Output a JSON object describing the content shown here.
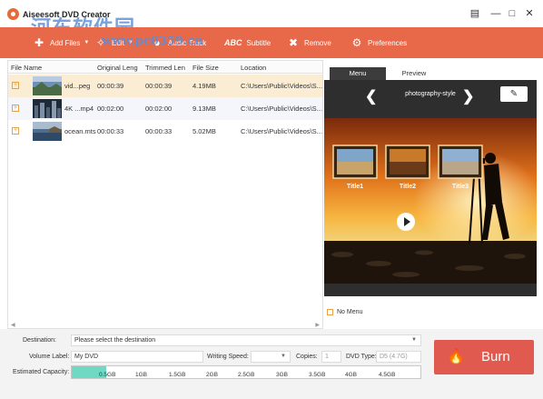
{
  "window": {
    "title": "Aiseesoft DVD Creator",
    "watermark": "河东软件园",
    "watermark_url": "www.pc0359.cn"
  },
  "toolbar": {
    "items": [
      {
        "label": "Add Files",
        "icon": "add-files-icon",
        "caret": true
      },
      {
        "label": "Edit",
        "icon": "edit-icon",
        "caret": true
      },
      {
        "label": "Audio Track",
        "icon": "microphone-icon"
      },
      {
        "label": "Subtitle",
        "icon": "abc-subtitle-icon",
        "icon_text": "ABC"
      },
      {
        "label": "Remove",
        "icon": "close-x-icon"
      },
      {
        "label": "Preferences",
        "icon": "gear-icon"
      }
    ]
  },
  "file_list": {
    "columns": [
      "File Name",
      "Original Leng",
      "Trimmed Len",
      "File Size",
      "Location"
    ],
    "rows": [
      {
        "name": "vid...peg",
        "original": "00:00:39",
        "trimmed": "00:00:39",
        "size": "4.19MB",
        "location": "C:\\Users\\Public\\Videos\\S...",
        "thumb": "landscape-thumbnail",
        "state": "selected"
      },
      {
        "name": "4K ...mp4",
        "original": "00:02:00",
        "trimmed": "00:02:00",
        "size": "9.13MB",
        "location": "C:\\Users\\Public\\Videos\\S...",
        "thumb": "city-thumbnail",
        "state": "hover"
      },
      {
        "name": "ocean.mts",
        "original": "00:00:33",
        "trimmed": "00:00:33",
        "size": "5.02MB",
        "location": "C:\\Users\\Public\\Videos\\S...",
        "thumb": "ocean-thumbnail",
        "state": "normal"
      }
    ]
  },
  "preview": {
    "tabs": [
      "Menu",
      "Preview"
    ],
    "active_tab": "Menu",
    "style_name": "photography-style",
    "titles": [
      "Title1",
      "Title2",
      "Title3"
    ],
    "no_menu_label": "No Menu",
    "no_menu_checked": false
  },
  "bottom": {
    "destination_label": "Destination:",
    "destination_placeholder": "Please select the destination",
    "volume_label": "Volume Label:",
    "volume_value": "My DVD",
    "writing_speed_label": "Writing Speed:",
    "copies_label": "Copies:",
    "copies_value": "1",
    "dvd_type_label": "DVD Type:",
    "dvd_type_value": "D5 (4.7G)",
    "capacity_label": "Estimated Capacity:",
    "capacity_ticks": [
      "0.5GB",
      "1GB",
      "1.5GB",
      "2GB",
      "2.5GB",
      "3GB",
      "3.5GB",
      "4GB",
      "4.5GB"
    ],
    "capacity_used_fraction": 0.025,
    "burn_label": "Burn"
  },
  "colors": {
    "toolbar": "#e8694a",
    "burn": "#e15a4f",
    "selected_row": "#fbecd4",
    "capacity_fill": "#6fd9c3"
  }
}
